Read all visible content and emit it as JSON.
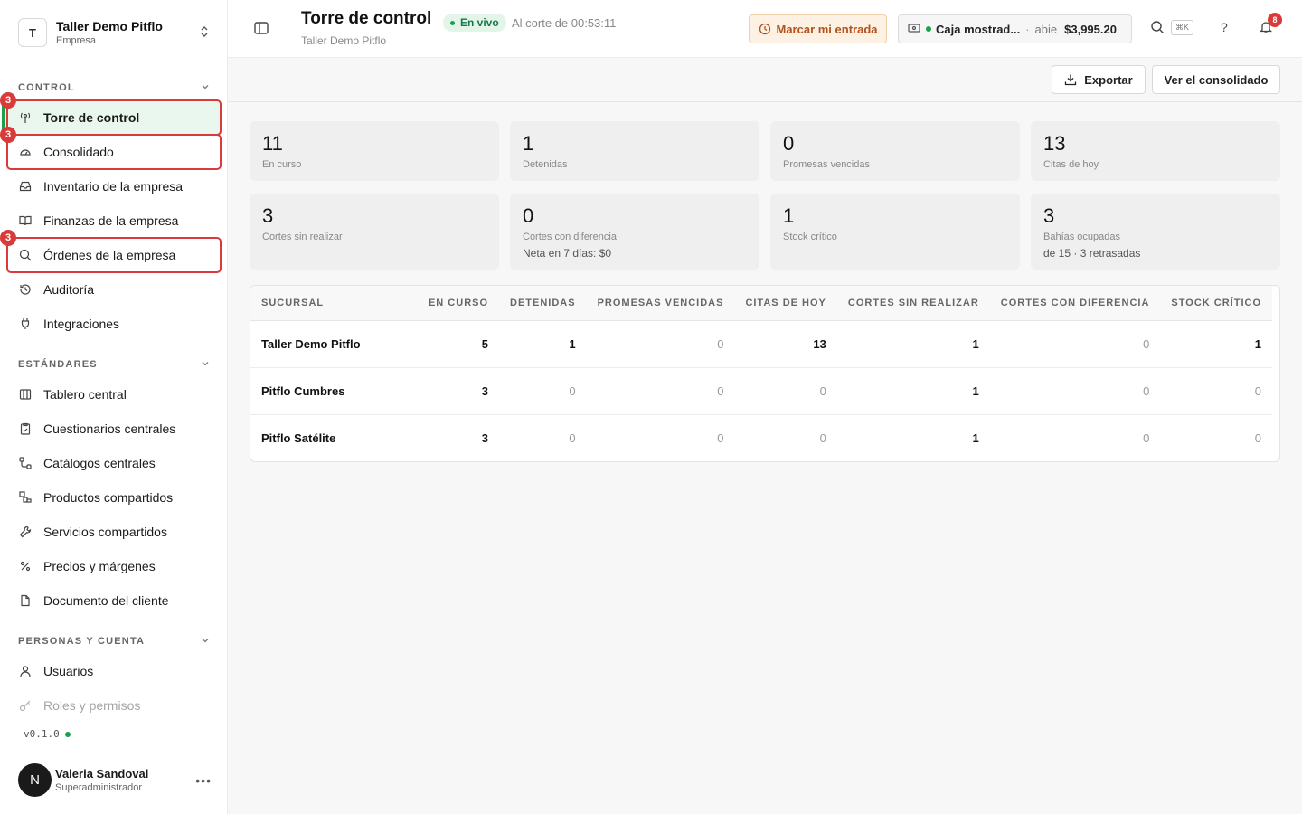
{
  "org": {
    "initial": "T",
    "name": "Taller Demo Pitflo",
    "type": "Empresa"
  },
  "sections": {
    "control": "CONTROL",
    "standards": "ESTÁNDARES",
    "people": "PERSONAS Y CUENTA"
  },
  "nav": {
    "torre": "Torre de control",
    "consolidado": "Consolidado",
    "inventario": "Inventario de la empresa",
    "finanzas": "Finanzas de la empresa",
    "ordenes": "Órdenes de la empresa",
    "auditoria": "Auditoría",
    "integraciones": "Integraciones",
    "tablero": "Tablero central",
    "cuestionarios": "Cuestionarios centrales",
    "catalogos": "Catálogos centrales",
    "productos": "Productos compartidos",
    "servicios": "Servicios compartidos",
    "precios": "Precios y márgenes",
    "documento": "Documento del cliente",
    "usuarios": "Usuarios",
    "roles": "Roles y permisos"
  },
  "annotations": {
    "badge": "3"
  },
  "version": "v0.1.0",
  "user": {
    "initial": "N",
    "name": "Valeria Sandoval",
    "role": "Superadministrador"
  },
  "header": {
    "title": "Torre de control",
    "subtitle": "Taller Demo Pitflo",
    "live": "En vivo",
    "cutoff": "Al corte de 00:53:11",
    "mark_entry": "Marcar mi entrada",
    "cash_name": "Caja mostrad...",
    "cash_status": "abie",
    "cash_amount": "$3,995.20",
    "shortcut": "⌘K",
    "help": "?",
    "notifications": "8"
  },
  "actions": {
    "export": "Exportar",
    "consolidated": "Ver el consolidado"
  },
  "kpis": {
    "en_curso": {
      "value": "11",
      "label": "En curso"
    },
    "detenidas": {
      "value": "1",
      "label": "Detenidas"
    },
    "promesas": {
      "value": "0",
      "label": "Promesas vencidas"
    },
    "citas": {
      "value": "13",
      "label": "Citas de hoy"
    },
    "cortes_sin": {
      "value": "3",
      "label": "Cortes sin realizar"
    },
    "cortes_dif": {
      "value": "0",
      "label": "Cortes con diferencia",
      "extra": "Neta en 7 días: $0"
    },
    "stock": {
      "value": "1",
      "label": "Stock crítico"
    },
    "bahias": {
      "value": "3",
      "label": "Bahías ocupadas",
      "extra": "de 15 · 3 retrasadas"
    }
  },
  "table": {
    "headers": [
      "SUCURSAL",
      "EN CURSO",
      "DETENIDAS",
      "PROMESAS VENCIDAS",
      "CITAS DE HOY",
      "CORTES SIN REALIZAR",
      "CORTES CON DIFERENCIA",
      "STOCK CRÍTICO"
    ],
    "rows": [
      [
        "Taller Demo Pitflo",
        "5",
        "1",
        "0",
        "13",
        "1",
        "0",
        "1"
      ],
      [
        "Pitflo Cumbres",
        "3",
        "0",
        "0",
        "0",
        "1",
        "0",
        "0"
      ],
      [
        "Pitflo Satélite",
        "3",
        "0",
        "0",
        "0",
        "1",
        "0",
        "0"
      ]
    ]
  }
}
